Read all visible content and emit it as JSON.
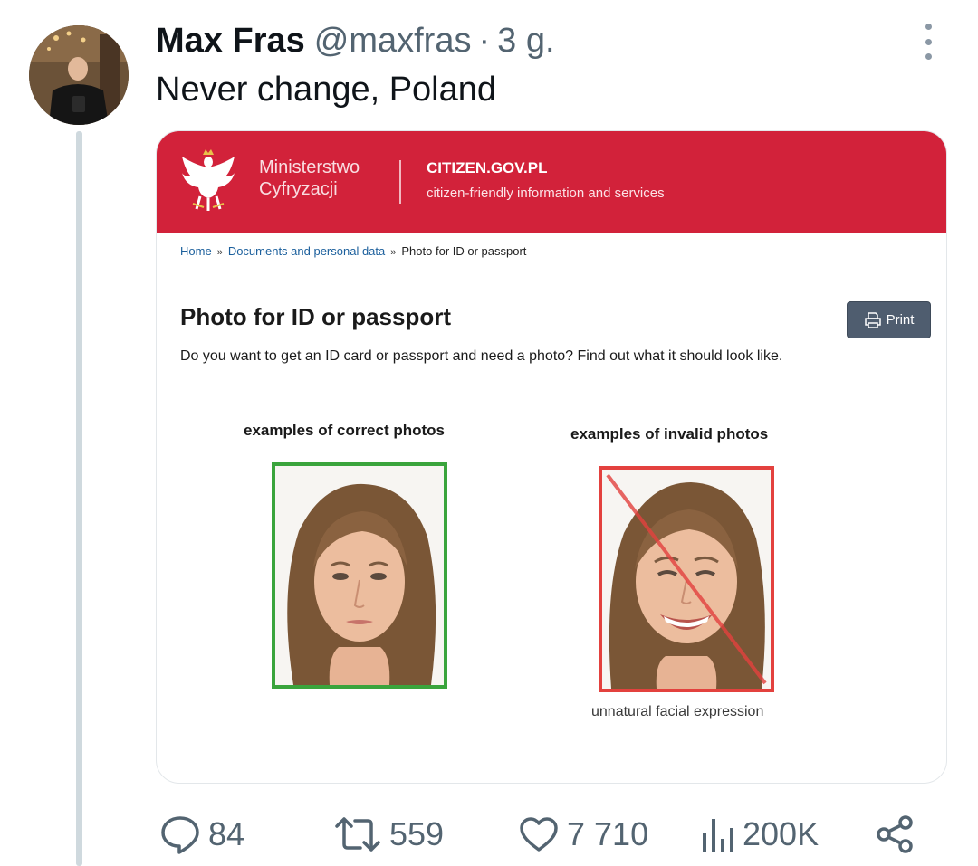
{
  "tweet": {
    "author_name": "Max Fras",
    "author_handle": "@maxfras",
    "separator": "·",
    "time": "3 g.",
    "text": "Never change, Poland"
  },
  "card": {
    "ministry_line1": "Ministerstwo",
    "ministry_line2": "Cyfryzacji",
    "site_name": "CITIZEN.GOV.PL",
    "site_tagline": "citizen-friendly information and services",
    "breadcrumb": {
      "home": "Home",
      "separator": "»",
      "section": "Documents and personal data",
      "current": "Photo for ID or passport"
    },
    "page_title": "Photo for ID or passport",
    "print_label": "Print",
    "intro": "Do you want to get an ID card or passport and need a photo? Find out what it should look like.",
    "correct_label": "examples of correct photos",
    "invalid_label": "examples of invalid photos",
    "invalid_caption": "unnatural facial expression"
  },
  "actions": {
    "replies": "84",
    "retweets": "559",
    "likes": "7 710",
    "views": "200K"
  },
  "colors": {
    "gov_red": "#d2223a",
    "correct_frame": "#3aa43c",
    "invalid_frame": "#e3413e",
    "muted_text": "#536471"
  },
  "icons": [
    "more-options-icon",
    "eagle-emblem-icon",
    "print-icon",
    "reply-icon",
    "retweet-icon",
    "like-icon",
    "views-icon",
    "share-icon"
  ]
}
